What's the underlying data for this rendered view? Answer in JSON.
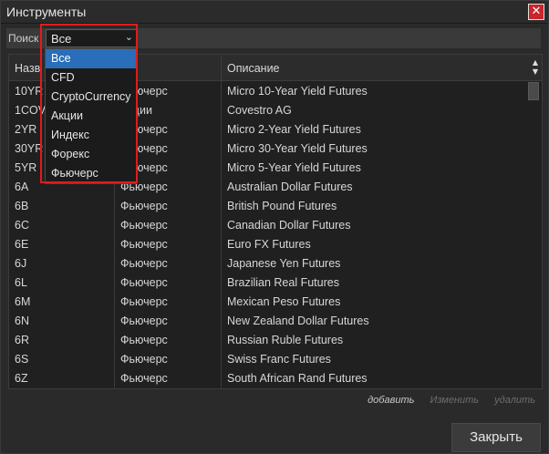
{
  "window": {
    "title": "Инструменты",
    "close_glyph": "✕"
  },
  "search": {
    "label": "Поиск",
    "selected": "Все",
    "options": [
      "Все",
      "CFD",
      "CryptoCurrency",
      "Акции",
      "Индекс",
      "Форекс",
      "Фьючерс"
    ]
  },
  "table": {
    "headers": [
      "Назв",
      "",
      "Описание"
    ],
    "rows": [
      [
        "10YR",
        "Фьючерс",
        "Micro 10-Year Yield Futures"
      ],
      [
        "1COV",
        "Акции",
        "Covestro AG"
      ],
      [
        "2YR",
        "Фьючерс",
        "Micro 2-Year Yield Futures"
      ],
      [
        "30YR",
        "Фьючерс",
        "Micro 30-Year Yield Futures"
      ],
      [
        "5YR",
        "Фьючерс",
        "Micro 5-Year Yield Futures"
      ],
      [
        "6A",
        "Фьючерс",
        "Australian Dollar Futures"
      ],
      [
        "6B",
        "Фьючерс",
        "British Pound Futures"
      ],
      [
        "6C",
        "Фьючерс",
        "Canadian Dollar Futures"
      ],
      [
        "6E",
        "Фьючерс",
        "Euro FX Futures"
      ],
      [
        "6J",
        "Фьючерс",
        "Japanese Yen Futures"
      ],
      [
        "6L",
        "Фьючерс",
        "Brazilian Real Futures"
      ],
      [
        "6M",
        "Фьючерс",
        "Mexican Peso Futures"
      ],
      [
        "6N",
        "Фьючерс",
        "New Zealand Dollar Futures"
      ],
      [
        "6R",
        "Фьючерс",
        "Russian Ruble Futures"
      ],
      [
        "6S",
        "Фьючерс",
        "Swiss Franc Futures"
      ],
      [
        "6Z",
        "Фьючерс",
        "South African Rand Futures"
      ]
    ]
  },
  "actions": {
    "add": "добавить",
    "edit": "Изменить",
    "delete": "удалить"
  },
  "footer": {
    "close_label": "Закрыть"
  },
  "colors": {
    "highlight": "#e21b1b",
    "selected_option": "#2a6db8",
    "close_icon": "#c8262a"
  }
}
